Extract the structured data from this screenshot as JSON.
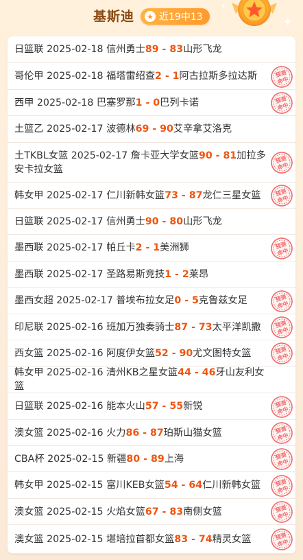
{
  "header": {
    "name": "基斯迪",
    "record": "近19中13"
  },
  "stamp_text": [
    "预测",
    "命中"
  ],
  "colors": {
    "score": "#ee5510",
    "title": "#8a4a12",
    "badge": "#ff9a2e",
    "stamp": "#f06a6a"
  },
  "matches": [
    {
      "league": "日篮联",
      "date": "2025-02-18",
      "home": "信州勇士",
      "home_score": "89",
      "away_score": "83",
      "away": "山形飞龙",
      "hit": false
    },
    {
      "league": "哥伦甲",
      "date": "2025-02-18",
      "home": "福塔雷绍查",
      "home_score": "2",
      "away_score": "1",
      "away": "阿古拉斯多拉达斯",
      "hit": true
    },
    {
      "league": "西甲",
      "date": "2025-02-18",
      "home": "巴塞罗那",
      "home_score": "1",
      "away_score": "0",
      "away": "巴列卡诺",
      "hit": true
    },
    {
      "league": "土篮乙",
      "date": "2025-02-17",
      "home": "波德林",
      "home_score": "69",
      "away_score": "90",
      "away": "艾辛拿艾洛克",
      "hit": false
    },
    {
      "league": "土TKBL女篮",
      "date": "2025-02-17",
      "home": "詹卡亚大学女篮",
      "home_score": "90",
      "away_score": "81",
      "away": "加拉多安卡拉女篮",
      "hit": true
    },
    {
      "league": "韩女甲",
      "date": "2025-02-17",
      "home": "仁川新韩女篮",
      "home_score": "73",
      "away_score": "87",
      "away": "龙仁三星女篮",
      "hit": true
    },
    {
      "league": "日篮联",
      "date": "2025-02-17",
      "home": "信州勇士",
      "home_score": "90",
      "away_score": "80",
      "away": "山形飞龙",
      "hit": false
    },
    {
      "league": "墨西联",
      "date": "2025-02-17",
      "home": "帕丘卡",
      "home_score": "2",
      "away_score": "1",
      "away": "美洲狮",
      "hit": true
    },
    {
      "league": "墨西联",
      "date": "2025-02-17",
      "home": "圣路易斯竞技",
      "home_score": "1",
      "away_score": "2",
      "away": "莱昂",
      "hit": false
    },
    {
      "league": "墨西女超",
      "date": "2025-02-17",
      "home": "普埃布拉女足",
      "home_score": "0",
      "away_score": "5",
      "away": "克鲁兹女足",
      "hit": true
    },
    {
      "league": "印尼联",
      "date": "2025-02-16",
      "home": "班加万独奏骑士",
      "home_score": "87",
      "away_score": "73",
      "away": "太平洋凯撒",
      "hit": true
    },
    {
      "league": "西女篮",
      "date": "2025-02-16",
      "home": "阿度伊女篮",
      "home_score": "52",
      "away_score": "90",
      "away": "尤文图特女篮",
      "hit": true
    },
    {
      "league": "韩女甲",
      "date": "2025-02-16",
      "home": "清州KB之星女篮",
      "home_score": "44",
      "away_score": "46",
      "away": "牙山友利女篮",
      "hit": false
    },
    {
      "league": "日篮联",
      "date": "2025-02-16",
      "home": "能本火山",
      "home_score": "57",
      "away_score": "55",
      "away": "新锐",
      "hit": true
    },
    {
      "league": "澳女篮",
      "date": "2025-02-16",
      "home": "火力",
      "home_score": "86",
      "away_score": "87",
      "away": "珀斯山猫女篮",
      "hit": true
    },
    {
      "league": "CBA杯",
      "date": "2025-02-15",
      "home": "新疆",
      "home_score": "80",
      "away_score": "89",
      "away": "上海",
      "hit": true
    },
    {
      "league": "韩女甲",
      "date": "2025-02-15",
      "home": "富川KEB女篮",
      "home_score": "54",
      "away_score": "64",
      "away": "仁川新韩女篮",
      "hit": true
    },
    {
      "league": "澳女篮",
      "date": "2025-02-15",
      "home": "火焰女篮",
      "home_score": "67",
      "away_score": "83",
      "away": "南侧女篮",
      "hit": true
    },
    {
      "league": "澳女篮",
      "date": "2025-02-15",
      "home": "堪培拉首都女篮",
      "home_score": "83",
      "away_score": "74",
      "away": "精灵女篮",
      "hit": true
    }
  ]
}
